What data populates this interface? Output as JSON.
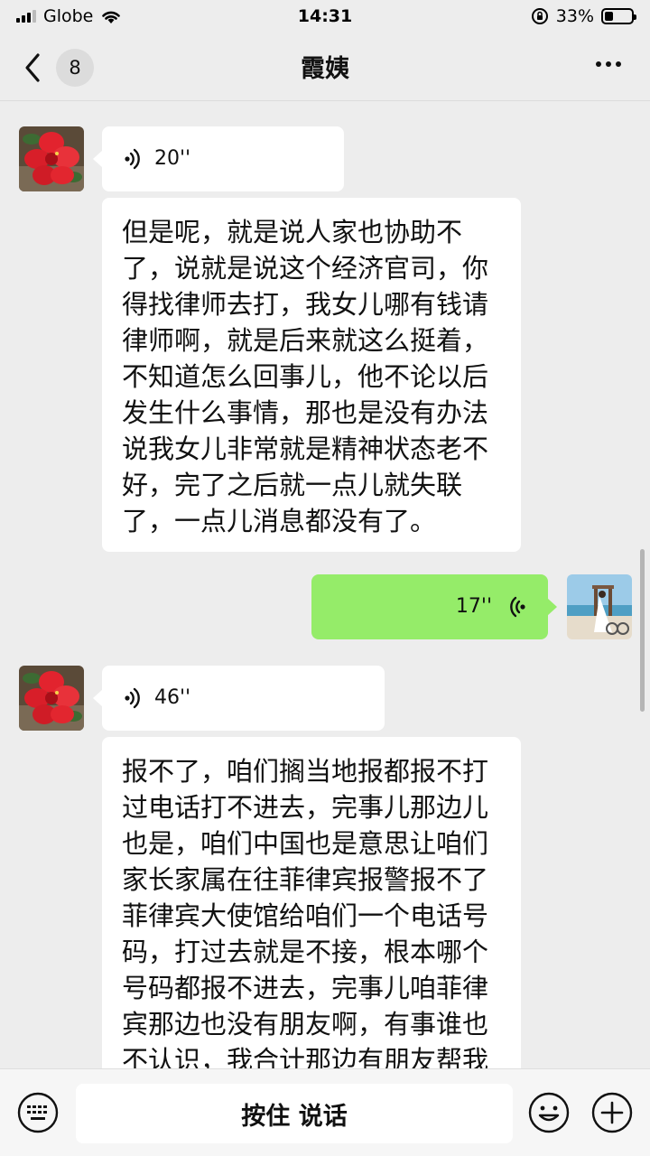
{
  "status_bar": {
    "carrier": "Globe",
    "time": "14:31",
    "battery": "33%",
    "battery_level": 0.33
  },
  "header": {
    "unread_count": "8",
    "title": "霞姨"
  },
  "messages": [
    {
      "side": "left",
      "type": "voice",
      "duration": "20''"
    },
    {
      "side": "left",
      "type": "text",
      "lines": [
        "但是呢，就是说人家也协助不",
        "了，说就是说这个经济官司，你",
        "得找律师去打，我女儿哪有钱请",
        "律师啊，就是后来就这么挺着，",
        "不知道怎么回事儿，他不论以后",
        "发生什么事情，那也是没有办法",
        "说我女儿非常就是精神状态老不",
        "好，完了之后就一点儿就失联",
        "了，一点儿消息都没有了。"
      ]
    },
    {
      "side": "right",
      "type": "voice",
      "duration": "17''"
    },
    {
      "side": "left",
      "type": "voice",
      "duration": "46''"
    },
    {
      "side": "left",
      "type": "text",
      "lines": [
        "报不了，咱们搁当地报都报不打",
        "过电话打不进去，完事儿那边儿",
        "也是，咱们中国也是意思让咱们",
        "家长家属在往菲律宾报警报不了",
        "菲律宾大使馆给咱们一个电话号",
        "码，打过去就是不接，根本哪个",
        "号码都报不进去，完事儿咱菲律",
        "宾那边也没有朋友啊，有事谁也",
        "不认识，我合计那边有朋友帮我"
      ]
    }
  ],
  "input_bar": {
    "hold_to_talk_label": "按住 说话"
  },
  "icons": {
    "back": "chevron-left-icon",
    "more": "more-dots-icon",
    "voice": "voice-wave-icon",
    "keyboard": "keyboard-icon",
    "emoji": "emoji-icon",
    "add": "plus-circle-icon"
  },
  "colors": {
    "background": "#ededed",
    "bubble_in": "#ffffff",
    "bubble_out": "#95ec69"
  }
}
